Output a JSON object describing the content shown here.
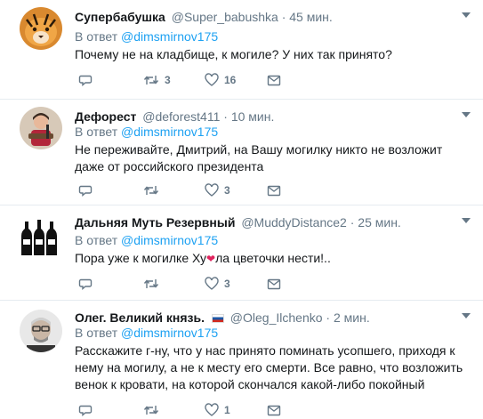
{
  "reply_prefix": "В ответ",
  "tweets": [
    {
      "name": "Супербабушка",
      "handle": "@Super_babushka",
      "time": "45 мин.",
      "reply_to": "@dimsmirnov175",
      "text": "Почему не на кладбище, к могиле? У них так принято?",
      "replies": "",
      "retweets": "3",
      "likes": "16"
    },
    {
      "name": "Дефорест",
      "handle": "@deforest411",
      "time": "10 мин.",
      "reply_to": "@dimsmirnov175",
      "text": "Не переживайте, Дмитрий, на Вашу могилку никто не возложит даже от российского президента",
      "replies": "",
      "retweets": "",
      "likes": "3"
    },
    {
      "name": "Дальняя Муть Резервный",
      "handle": "@MuddyDistance2",
      "time": "25 мин.",
      "reply_to": "@dimsmirnov175",
      "text_before": "Пора уже к могилке Ху",
      "text_emoji": "❤",
      "text_after": "ла цветочки нести!..",
      "replies": "",
      "retweets": "",
      "likes": "3"
    },
    {
      "name": "Олег. Великий князь.",
      "handle": "@Oleg_Ilchenko",
      "time": "2 мин.",
      "reply_to": "@dimsmirnov175",
      "text": "Расскажите г-ну, что у нас принято поминать усопшего, приходя к нему на могилу, а не к месту его смерти. Все равно, что возложить венок к кровати, на которой скончался какой-либо покойный",
      "replies": "",
      "retweets": "",
      "likes": "1"
    }
  ],
  "dot": "·",
  "colors": {
    "text": "#14171a",
    "muted": "#657786",
    "link": "#1da1f2",
    "divider": "#e6ecf0"
  },
  "icons": [
    "reply-icon",
    "retweet-icon",
    "like-icon",
    "dm-icon",
    "caret-down-icon"
  ]
}
